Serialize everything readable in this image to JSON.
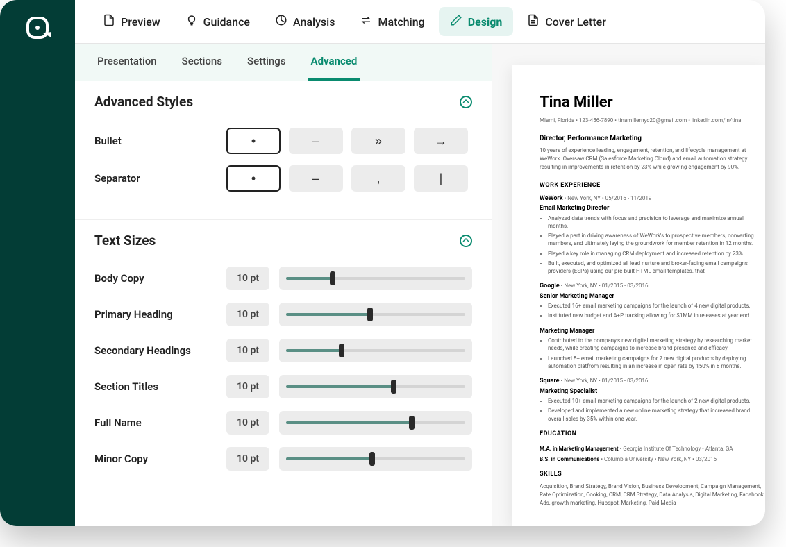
{
  "nav": {
    "items": [
      {
        "label": "Preview",
        "icon": "file"
      },
      {
        "label": "Guidance",
        "icon": "bulb"
      },
      {
        "label": "Analysis",
        "icon": "pie"
      },
      {
        "label": "Matching",
        "icon": "swap"
      },
      {
        "label": "Design",
        "icon": "pen"
      },
      {
        "label": "Cover Letter",
        "icon": "doc"
      }
    ],
    "active": "Design"
  },
  "subtabs": {
    "items": [
      "Presentation",
      "Sections",
      "Settings",
      "Advanced"
    ],
    "active": "Advanced"
  },
  "advanced": {
    "title": "Advanced Styles",
    "bullet": {
      "label": "Bullet",
      "options": [
        "•",
        "–",
        "»",
        "→"
      ],
      "selected": 0
    },
    "separator": {
      "label": "Separator",
      "options": [
        "•",
        "–",
        ",",
        "|"
      ],
      "selected": 0
    }
  },
  "textsizes": {
    "title": "Text Sizes",
    "rows": [
      {
        "label": "Body Copy",
        "value": "10 pt",
        "pct": 26
      },
      {
        "label": "Primary Heading",
        "value": "10 pt",
        "pct": 47
      },
      {
        "label": "Secondary Headings",
        "value": "10 pt",
        "pct": 31
      },
      {
        "label": "Section Titles",
        "value": "10 pt",
        "pct": 60
      },
      {
        "label": "Full Name",
        "value": "10 pt",
        "pct": 70
      },
      {
        "label": "Minor Copy",
        "value": "10 pt",
        "pct": 48
      }
    ]
  },
  "resume": {
    "name": "Tina Miller",
    "contact": "Miami, Florida  •  123-456-7890  •  tinamillernyc20@gmail.com  •  linkedin.com/in/tina",
    "subtitle": "Director, Performance Marketing",
    "summary": "10 years of experience leading, engagement, retention, and lifecycle management at WeWork. Oversaw CRM (Salesforce Marketing Cloud) and email automation strategy resulting in improvements in retention by 23% while growing engagement by 90%.",
    "work_title": "WORK EXPERIENCE",
    "jobs": [
      {
        "company": "WeWork",
        "loc": "New York, NY",
        "dates": "05/2016 - 11/2019",
        "title": "Email Marketing Director",
        "bullets": [
          "Analyzed data trends with focus and precision to leverage and maximize annual months.",
          "Played a part in driving awareness of WeWork's to prospective members, converting members, and ultimately laying the groundwork for member retention in 12 months.",
          "Played a key role in managing CRM deployment and increased retention by 23%.",
          "Built, executed, and optimized all lead nurture and broker-facing email campaigns providers (ESPs) using our pre-built HTML email templates. that"
        ]
      },
      {
        "company": "Google",
        "loc": "New York, NY",
        "dates": "01/2015 - 03/2016",
        "title": "Senior Marketing Manager",
        "bullets": [
          "Executed 16+ email marketing campaigns for the launch of 4 new digital products.",
          "Instituted new budget and A+P tracking allowing for $1MM in releases at year end."
        ]
      },
      {
        "company": "",
        "loc": "",
        "dates": "",
        "title": "Marketing Manager",
        "bullets": [
          "Contributed to the company's new digital marketing strategy by researching market needs, while creating campaigns to increase brand presence and efficacy.",
          "Launched 8+ email marketing campaigns for 2 new digital products by deploying automation platfrom resulting in an increase in open rate by 150% in 8 months."
        ]
      },
      {
        "company": "Square",
        "loc": "New York, NY",
        "dates": "01/2015 - 03/2016",
        "title": "Marketing Specialist",
        "bullets": [
          "Executed 10+ email marketing campaigns for the launch of 2 new digital products.",
          "Developed and implemented a new online marketing strategy that increased brand overall sales by 35% within one year."
        ]
      }
    ],
    "edu_title": "EDUCATION",
    "education": [
      {
        "degree": "M.A. in Marketing Management",
        "school": "Georgia Institute Of Technology",
        "loc": "Atlanta, GA"
      },
      {
        "degree": "B.S. in Communications",
        "school": "Columbia University",
        "loc": "New York, NY",
        "dates": "03/2016"
      }
    ],
    "skills_title": "SKILLS",
    "skills": "Acquisition, Brand Strategy, Brand Vision, Business Development, Campaign Management, Rate Optimization, Cooking, CRM, CRM Strategy, Data Analysis, Digital Marketing, Facebook Ads, growth marketing, Hubspot, Marketing, Paid Media"
  }
}
